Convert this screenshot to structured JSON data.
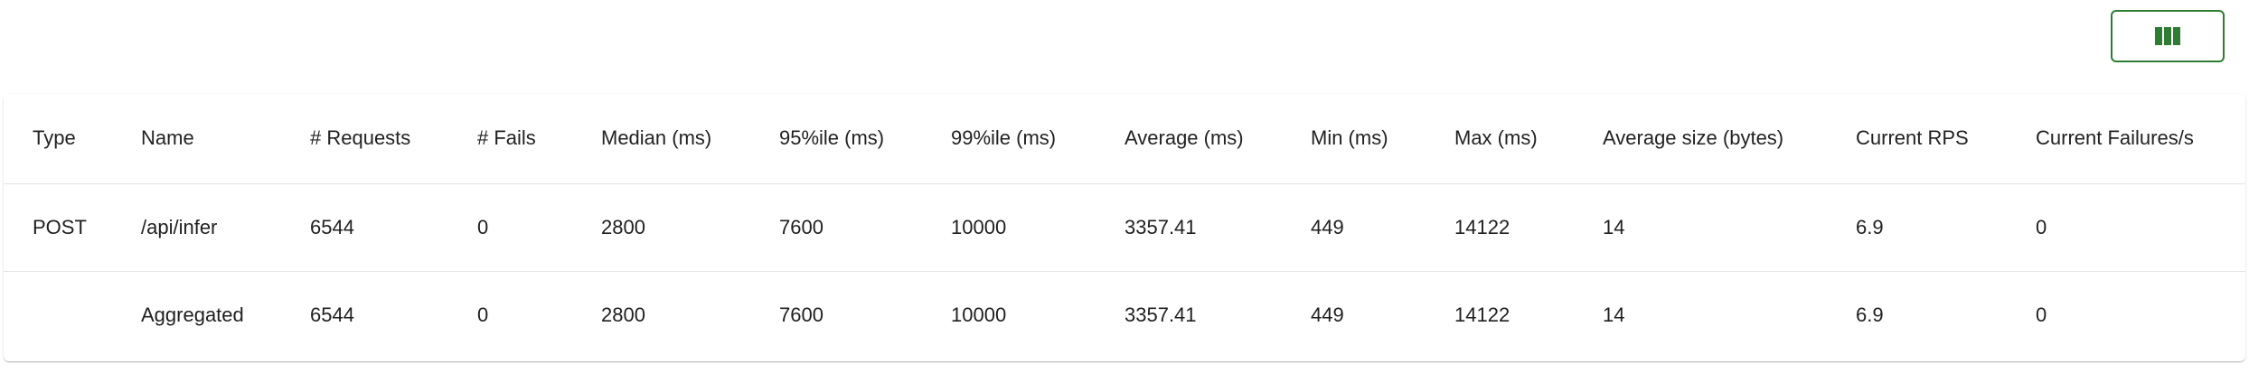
{
  "toolbar": {
    "columns_icon": "column-toggle-icon"
  },
  "table": {
    "headers": [
      "Type",
      "Name",
      "# Requests",
      "# Fails",
      "Median (ms)",
      "95%ile (ms)",
      "99%ile (ms)",
      "Average (ms)",
      "Min (ms)",
      "Max (ms)",
      "Average size (bytes)",
      "Current RPS",
      "Current Failures/s"
    ],
    "rows": [
      [
        "POST",
        "/api/infer",
        "6544",
        "0",
        "2800",
        "7600",
        "10000",
        "3357.41",
        "449",
        "14122",
        "14",
        "6.9",
        "0"
      ],
      [
        "",
        "Aggregated",
        "6544",
        "0",
        "2800",
        "7600",
        "10000",
        "3357.41",
        "449",
        "14122",
        "14",
        "6.9",
        "0"
      ]
    ]
  },
  "colors": {
    "accent": "#2e7d32",
    "divider": "#e3e3e3"
  }
}
